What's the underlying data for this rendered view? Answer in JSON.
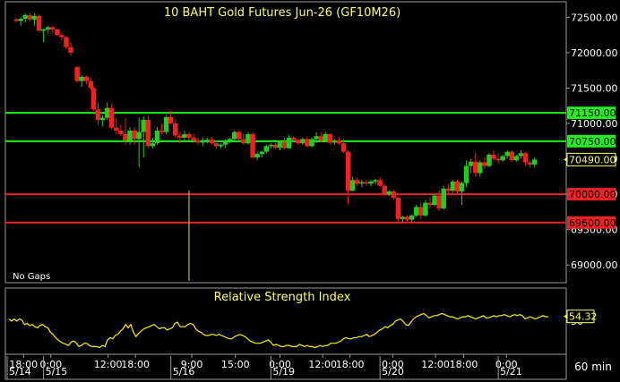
{
  "colors": {
    "background": "#000000",
    "frame": "#9a9a9a",
    "text": "#ffffff",
    "title": "#ffff66",
    "up_candle": "#22cc22",
    "down_candle": "#ee2222",
    "support_line": "#ee2222",
    "resistance_line": "#22ee22",
    "rsi_line": "#ffee00",
    "price_tag": "#ffff66"
  },
  "chart_data": [
    {
      "type": "candlestick",
      "title": "10 BAHT Gold Futures Jun-26 (GF10M26)",
      "note": "No Gaps",
      "ylim": [
        68750,
        72720
      ],
      "y_ticks": [
        69000,
        69500,
        70000,
        70500,
        71000,
        71500,
        72000,
        72500
      ],
      "y_tick_labels": [
        "69000.00",
        "69500.00",
        "70000.00",
        "70500.00",
        "71000.00",
        "71500.00",
        "72000.00",
        "72500.00"
      ],
      "horizontal_lines": [
        {
          "value": 71150,
          "label": "71150.00",
          "color": "#22ee22"
        },
        {
          "value": 70750,
          "label": "70750.00",
          "color": "#22ee22"
        },
        {
          "value": 70000,
          "label": "70000.00",
          "color": "#ee2222"
        },
        {
          "value": 69600,
          "label": "69600.00",
          "color": "#ee2222"
        }
      ],
      "last_price": {
        "value": 70490,
        "label": "70490.00"
      },
      "candles": [
        [
          2.0,
          72470,
          72490,
          72430,
          72450
        ],
        [
          2.5,
          72450,
          72500,
          72380,
          72480
        ],
        [
          3.0,
          72480,
          72560,
          72430,
          72530
        ],
        [
          3.5,
          72530,
          72560,
          72450,
          72470
        ],
        [
          4.0,
          72470,
          72560,
          72380,
          72520
        ],
        [
          4.5,
          72520,
          72540,
          72300,
          72310
        ],
        [
          5.0,
          72310,
          72340,
          72150,
          72330
        ],
        [
          5.5,
          72330,
          72380,
          72280,
          72360
        ],
        [
          6.0,
          72360,
          72380,
          72280,
          72330
        ],
        [
          6.5,
          72330,
          72350,
          72230,
          72250
        ],
        [
          7.0,
          72250,
          72280,
          72180,
          72220
        ],
        [
          7.5,
          72220,
          72240,
          72050,
          72080
        ],
        [
          8.0,
          72080,
          72150,
          71960,
          72000
        ],
        [
          8.7,
          71800,
          71800,
          71580,
          71600
        ],
        [
          9.2,
          71600,
          71680,
          71520,
          71660
        ],
        [
          9.7,
          71660,
          71680,
          71550,
          71600
        ],
        [
          10.2,
          71600,
          71650,
          71480,
          71500
        ],
        [
          10.5,
          71500,
          71520,
          71180,
          71200
        ],
        [
          11.0,
          71200,
          71300,
          70980,
          71050
        ],
        [
          11.5,
          71050,
          71120,
          70960,
          71080
        ],
        [
          12.0,
          71080,
          71300,
          71050,
          71220
        ],
        [
          12.5,
          71220,
          71280,
          70920,
          70940
        ],
        [
          13.0,
          70940,
          71080,
          70850,
          70900
        ],
        [
          13.5,
          70900,
          70980,
          70820,
          70850
        ],
        [
          14.0,
          70850,
          71080,
          70700,
          70760
        ],
        [
          14.5,
          70760,
          70950,
          70700,
          70900
        ],
        [
          15.0,
          70900,
          70950,
          70700,
          70780
        ],
        [
          15.5,
          70780,
          71080,
          70380,
          70880
        ],
        [
          16.0,
          70880,
          71100,
          70520,
          71050
        ],
        [
          16.5,
          71050,
          71120,
          70650,
          70680
        ],
        [
          17.0,
          70680,
          70800,
          70650,
          70720
        ],
        [
          17.5,
          70720,
          70950,
          70700,
          70900
        ],
        [
          18.0,
          70900,
          71000,
          70850,
          70880
        ],
        [
          18.5,
          70880,
          71120,
          70850,
          71090
        ],
        [
          19.0,
          71090,
          71180,
          70980,
          71000
        ],
        [
          19.5,
          71000,
          71060,
          70800,
          70830
        ],
        [
          20.0,
          70830,
          70880,
          70720,
          70800
        ],
        [
          20.5,
          70800,
          70900,
          70750,
          70850
        ],
        [
          21.0,
          70850,
          70880,
          70760,
          70800
        ],
        [
          21.5,
          70800,
          70850,
          70740,
          70760
        ],
        [
          22.0,
          70760,
          70800,
          70700,
          70730
        ],
        [
          22.5,
          70730,
          70800,
          70680,
          70750
        ],
        [
          23.0,
          70750,
          70800,
          70720,
          70770
        ],
        [
          23.5,
          70770,
          70800,
          70700,
          70720
        ],
        [
          24.0,
          70720,
          70760,
          70650,
          70680
        ],
        [
          24.5,
          70680,
          70720,
          70650,
          70700
        ],
        [
          25.0,
          70700,
          70780,
          70650,
          70760
        ],
        [
          25.5,
          70760,
          70800,
          70720,
          70780
        ],
        [
          26.0,
          70780,
          70900,
          70760,
          70880
        ],
        [
          26.5,
          70880,
          70900,
          70760,
          70780
        ],
        [
          27.0,
          70780,
          70850,
          70700,
          70720
        ],
        [
          27.5,
          70720,
          70880,
          70700,
          70850
        ],
        [
          28.0,
          70850,
          70880,
          70500,
          70520
        ],
        [
          28.5,
          70520,
          70600,
          70480,
          70570
        ],
        [
          29.0,
          70570,
          70620,
          70520,
          70600
        ],
        [
          29.5,
          70600,
          70700,
          70580,
          70680
        ],
        [
          30.0,
          70680,
          70720,
          70650,
          70700
        ],
        [
          30.5,
          70700,
          70720,
          70640,
          70660
        ],
        [
          31.0,
          70660,
          70760,
          70620,
          70740
        ],
        [
          31.5,
          70740,
          70800,
          70640,
          70650
        ],
        [
          32.0,
          70650,
          70840,
          70640,
          70800
        ],
        [
          32.5,
          70800,
          70820,
          70750,
          70770
        ],
        [
          33.0,
          70770,
          70780,
          70700,
          70720
        ],
        [
          33.5,
          70720,
          70800,
          70700,
          70780
        ],
        [
          34.0,
          70780,
          70820,
          70660,
          70680
        ],
        [
          34.5,
          70680,
          70800,
          70660,
          70780
        ],
        [
          35.0,
          70780,
          70880,
          70720,
          70820
        ],
        [
          35.5,
          70820,
          70880,
          70740,
          70760
        ],
        [
          36.0,
          70760,
          70880,
          70740,
          70850
        ],
        [
          36.5,
          70850,
          70860,
          70710,
          70730
        ],
        [
          37.0,
          70730,
          70780,
          70700,
          70760
        ],
        [
          37.5,
          70760,
          70800,
          70700,
          70720
        ],
        [
          38.0,
          70720,
          70780,
          70580,
          70600
        ],
        [
          38.5,
          70600,
          70620,
          69850,
          70050
        ],
        [
          39.0,
          70050,
          70250,
          70040,
          70200
        ],
        [
          39.5,
          70200,
          70230,
          70120,
          70150
        ],
        [
          40.0,
          70150,
          70200,
          70100,
          70170
        ],
        [
          40.5,
          70170,
          70200,
          70120,
          70150
        ],
        [
          41.0,
          70150,
          70200,
          70110,
          70180
        ],
        [
          41.5,
          70180,
          70220,
          70140,
          70200
        ],
        [
          42.0,
          70200,
          70240,
          70100,
          70120
        ],
        [
          42.5,
          70120,
          70150,
          69980,
          70000
        ],
        [
          43.0,
          70000,
          70060,
          69980,
          70040
        ],
        [
          43.5,
          70040,
          70060,
          69920,
          69950
        ],
        [
          44.0,
          69950,
          69960,
          69620,
          69650
        ],
        [
          44.5,
          69650,
          69700,
          69600,
          69680
        ],
        [
          45.0,
          69680,
          69700,
          69600,
          69640
        ],
        [
          45.5,
          69640,
          69720,
          69600,
          69700
        ],
        [
          46.0,
          69700,
          69850,
          69680,
          69820
        ],
        [
          46.5,
          69820,
          69880,
          69650,
          69700
        ],
        [
          47.0,
          69700,
          69920,
          69680,
          69880
        ],
        [
          47.5,
          69880,
          69960,
          69800,
          69850
        ],
        [
          48.0,
          69850,
          70000,
          69830,
          69980
        ],
        [
          48.5,
          69980,
          70060,
          69760,
          69800
        ],
        [
          49.0,
          69800,
          70120,
          69780,
          70080
        ],
        [
          49.5,
          70080,
          70140,
          70000,
          70050
        ],
        [
          50.0,
          70050,
          70200,
          70020,
          70180
        ],
        [
          50.5,
          70180,
          70200,
          70000,
          70040
        ],
        [
          51.0,
          70040,
          70180,
          69850,
          70160
        ],
        [
          51.5,
          70160,
          70480,
          70100,
          70400
        ],
        [
          52.0,
          70400,
          70500,
          70300,
          70460
        ],
        [
          52.5,
          70460,
          70580,
          70250,
          70300
        ],
        [
          53.0,
          70300,
          70480,
          70250,
          70450
        ],
        [
          53.5,
          70450,
          70520,
          70360,
          70400
        ],
        [
          54.0,
          70400,
          70580,
          70380,
          70560
        ],
        [
          54.5,
          70560,
          70620,
          70480,
          70500
        ],
        [
          55.0,
          70500,
          70580,
          70440,
          70480
        ],
        [
          55.5,
          70480,
          70560,
          70460,
          70540
        ],
        [
          56.0,
          70540,
          70620,
          70500,
          70600
        ],
        [
          56.5,
          70600,
          70620,
          70460,
          70480
        ],
        [
          57.0,
          70480,
          70560,
          70460,
          70540
        ],
        [
          57.5,
          70540,
          70620,
          70500,
          70580
        ],
        [
          58.0,
          70580,
          70600,
          70400,
          70450
        ],
        [
          58.5,
          70450,
          70480,
          70380,
          70420
        ],
        [
          59.0,
          70420,
          70520,
          70380,
          70490
        ]
      ],
      "candle_columns": [
        "x",
        "open",
        "high",
        "low",
        "close"
      ]
    },
    {
      "type": "line",
      "title": "Relative Strength Index",
      "ylim": [
        20,
        80
      ],
      "y_ticks": [
        50
      ],
      "y_tick_labels": [
        "50"
      ],
      "last_value": {
        "value": 54.32,
        "label": "54.32"
      },
      "values": [
        52,
        50,
        52,
        50,
        52,
        51,
        47,
        48,
        46,
        47,
        45,
        44,
        46,
        47,
        45,
        44,
        40,
        38,
        35,
        33,
        31,
        30,
        29,
        28,
        31,
        32,
        30,
        27,
        28,
        30,
        30,
        28,
        27,
        27,
        27,
        26,
        28,
        27,
        33,
        35,
        34,
        37,
        38,
        41,
        43,
        47,
        44,
        47,
        40,
        36,
        39,
        41,
        43,
        44,
        45,
        46,
        47,
        45,
        43,
        44,
        44,
        42,
        43,
        44,
        48,
        49,
        45,
        45,
        45,
        47,
        48,
        47,
        43,
        41,
        40,
        38,
        37,
        37,
        38,
        38,
        37,
        38,
        37,
        36,
        35,
        34,
        34,
        36,
        37,
        38,
        37,
        36,
        34,
        32,
        31,
        30,
        30,
        30,
        31,
        32,
        33,
        31,
        28,
        29,
        28,
        27,
        27,
        28,
        28,
        27,
        27,
        27,
        29,
        28,
        27,
        28,
        27,
        27,
        26,
        27,
        28,
        27,
        28,
        28,
        30,
        30,
        30,
        31,
        32,
        34,
        35,
        34,
        34,
        35,
        35,
        36,
        36,
        37,
        38,
        36,
        37,
        38,
        40,
        42,
        43,
        45,
        44,
        46,
        47,
        50,
        51,
        52,
        50,
        47,
        46,
        49,
        52,
        54,
        55,
        56,
        57,
        55,
        53,
        54,
        55,
        55,
        56,
        57,
        56,
        55,
        54,
        54,
        53,
        52,
        53,
        54,
        54,
        55,
        54,
        53,
        52,
        53,
        54,
        55,
        53,
        53,
        54,
        55,
        54,
        55,
        55,
        56,
        55,
        54,
        55,
        56,
        55,
        56,
        55,
        52,
        53,
        54,
        53,
        52,
        53,
        54,
        55,
        54,
        54
      ]
    }
  ],
  "x_axis": {
    "time_labels": [
      {
        "x": 2.8,
        "label": "18:00"
      },
      {
        "x": 5.8,
        "label": "0:00"
      },
      {
        "x": 12.1,
        "label": "12:00"
      },
      {
        "x": 15.1,
        "label": "18:00"
      },
      {
        "x": 21.3,
        "label": "9:00"
      },
      {
        "x": 26.1,
        "label": "15:00"
      },
      {
        "x": 31.0,
        "label": "0:00"
      },
      {
        "x": 35.7,
        "label": "12:00"
      },
      {
        "x": 38.7,
        "label": "18:00"
      },
      {
        "x": 43.4,
        "label": "0:00"
      },
      {
        "x": 48.1,
        "label": "12:00"
      },
      {
        "x": 51.2,
        "label": "18:00"
      },
      {
        "x": 55.9,
        "label": "0:00"
      }
    ],
    "date_labels": [
      {
        "x": 1.0,
        "label": "5/14"
      },
      {
        "x": 5.0,
        "label": "5/15"
      },
      {
        "x": 19.0,
        "label": "5/16"
      },
      {
        "x": 30.0,
        "label": "5/19"
      },
      {
        "x": 42.0,
        "label": "5/20"
      },
      {
        "x": 55.0,
        "label": "5/21"
      }
    ],
    "interval_label": "60 min",
    "xlim": [
      1,
      63.5
    ]
  },
  "volume_spike_x": 21.0
}
